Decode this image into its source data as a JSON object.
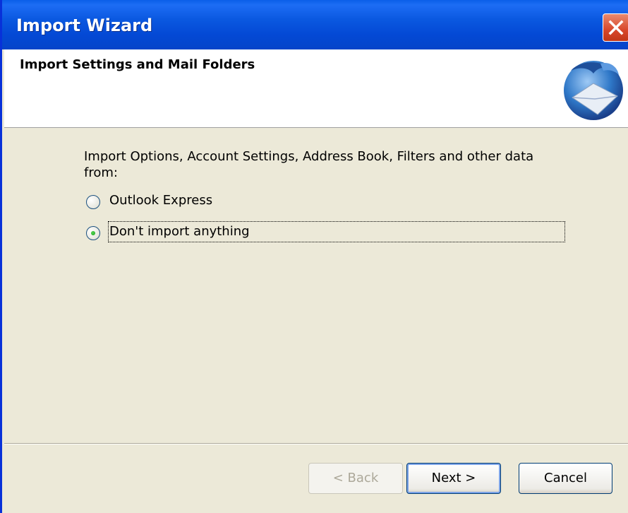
{
  "window": {
    "title": "Import Wizard"
  },
  "header": {
    "title": "Import Settings and Mail Folders",
    "icon": "thunderbird-logo-icon"
  },
  "content": {
    "intro": "Import Options, Account Settings, Address Book, Filters and other data from:",
    "options": [
      {
        "label": "Outlook Express",
        "selected": false
      },
      {
        "label": "Don't import anything",
        "selected": true
      }
    ]
  },
  "buttons": {
    "back": "< Back",
    "next": "Next >",
    "cancel": "Cancel"
  },
  "colors": {
    "titlebar": "#0449d5",
    "dialog_bg": "#ece9d8",
    "close": "#d8462a"
  }
}
